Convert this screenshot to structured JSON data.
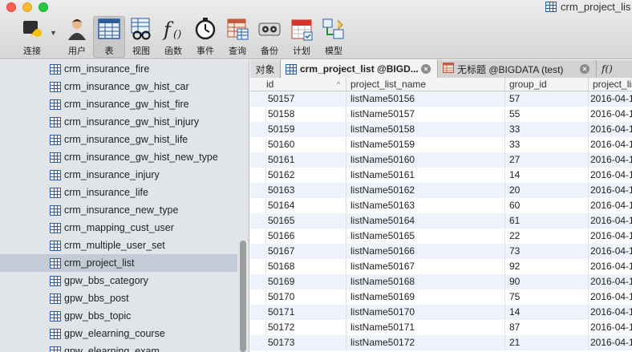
{
  "window": {
    "title": "crm_project_lis"
  },
  "toolbar": {
    "items": [
      {
        "label": "连接",
        "icon": "connection-icon"
      },
      {
        "label": "用户",
        "icon": "user-icon"
      },
      {
        "label": "表",
        "icon": "table-icon",
        "active": true
      },
      {
        "label": "视图",
        "icon": "view-icon"
      },
      {
        "label": "函数",
        "icon": "function-icon"
      },
      {
        "label": "事件",
        "icon": "event-clock-icon"
      },
      {
        "label": "查询",
        "icon": "query-icon"
      },
      {
        "label": "备份",
        "icon": "backup-icon"
      },
      {
        "label": "计划",
        "icon": "schedule-calendar-icon"
      },
      {
        "label": "模型",
        "icon": "model-icon"
      }
    ]
  },
  "sidebar": {
    "items": [
      {
        "label": "crm_insurance_fire"
      },
      {
        "label": "crm_insurance_gw_hist_car"
      },
      {
        "label": "crm_insurance_gw_hist_fire"
      },
      {
        "label": "crm_insurance_gw_hist_injury"
      },
      {
        "label": "crm_insurance_gw_hist_life"
      },
      {
        "label": "crm_insurance_gw_hist_new_type"
      },
      {
        "label": "crm_insurance_injury"
      },
      {
        "label": "crm_insurance_life"
      },
      {
        "label": "crm_insurance_new_type"
      },
      {
        "label": "crm_mapping_cust_user"
      },
      {
        "label": "crm_multiple_user_set"
      },
      {
        "label": "crm_project_list",
        "selected": true
      },
      {
        "label": "gpw_bbs_category"
      },
      {
        "label": "gpw_bbs_post"
      },
      {
        "label": "gpw_bbs_topic"
      },
      {
        "label": "gpw_elearning_course"
      },
      {
        "label": "gpw_elearning_exam"
      }
    ]
  },
  "tabs": {
    "objects": "对象",
    "tab1": "crm_project_list @BIGD...",
    "tab2": "无标题 @BIGDATA (test)",
    "tab3": "f()"
  },
  "table": {
    "columns": [
      "id",
      "project_list_name",
      "group_id",
      "project_lis"
    ],
    "rows": [
      [
        "50157",
        "listName50156",
        "57",
        "2016-04-1"
      ],
      [
        "50158",
        "listName50157",
        "55",
        "2016-04-1"
      ],
      [
        "50159",
        "listName50158",
        "33",
        "2016-04-1"
      ],
      [
        "50160",
        "listName50159",
        "33",
        "2016-04-1"
      ],
      [
        "50161",
        "listName50160",
        "27",
        "2016-04-1"
      ],
      [
        "50162",
        "listName50161",
        "14",
        "2016-04-1"
      ],
      [
        "50163",
        "listName50162",
        "20",
        "2016-04-1"
      ],
      [
        "50164",
        "listName50163",
        "60",
        "2016-04-1"
      ],
      [
        "50165",
        "listName50164",
        "61",
        "2016-04-1"
      ],
      [
        "50166",
        "listName50165",
        "22",
        "2016-04-1"
      ],
      [
        "50167",
        "listName50166",
        "73",
        "2016-04-1"
      ],
      [
        "50168",
        "listName50167",
        "92",
        "2016-04-1"
      ],
      [
        "50169",
        "listName50168",
        "90",
        "2016-04-1"
      ],
      [
        "50170",
        "listName50169",
        "75",
        "2016-04-1"
      ],
      [
        "50171",
        "listName50170",
        "14",
        "2016-04-1"
      ],
      [
        "50172",
        "listName50171",
        "87",
        "2016-04-1"
      ],
      [
        "50173",
        "listName50172",
        "21",
        "2016-04-1"
      ]
    ]
  }
}
